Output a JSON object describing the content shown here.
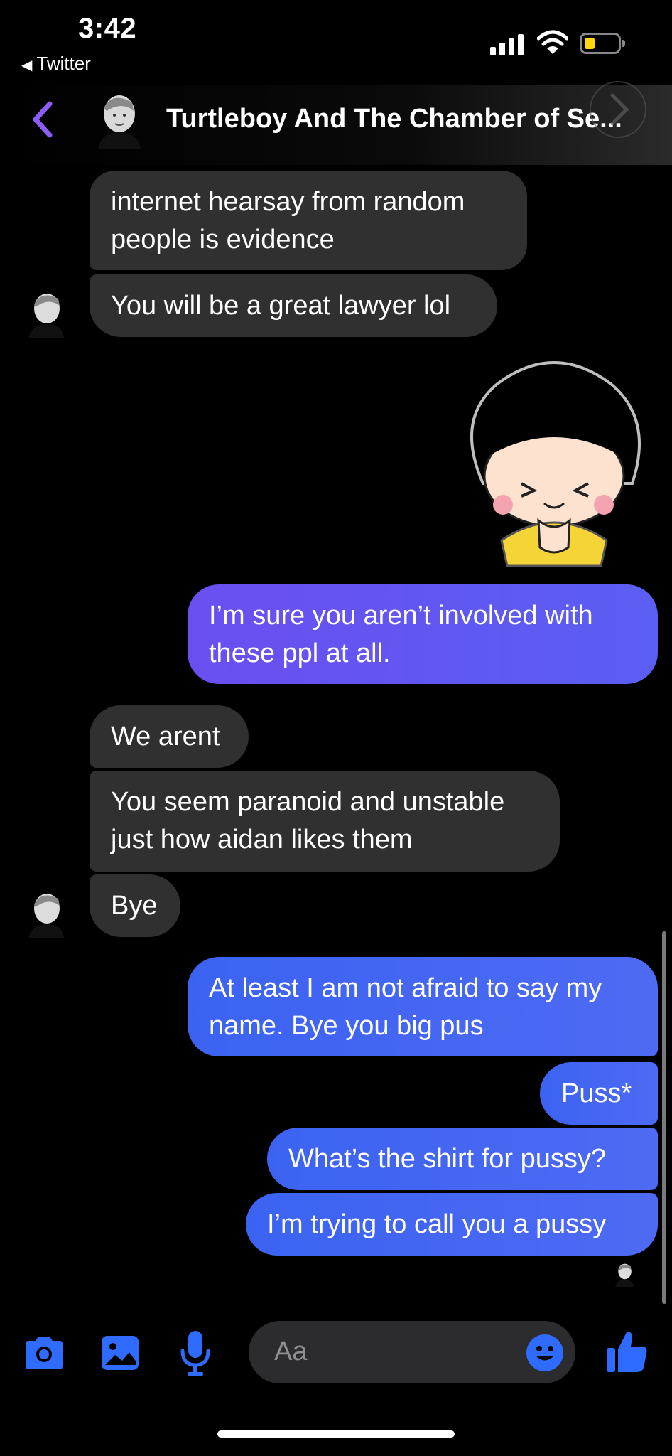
{
  "status_bar": {
    "time": "3:42",
    "back_app": "Twitter"
  },
  "header": {
    "title": "Turtleboy And The Chamber of Se..."
  },
  "messages": [
    {
      "dir": "in",
      "lines": [
        "internet hearsay from random",
        "people is evidence"
      ]
    },
    {
      "dir": "in",
      "lines": [
        "You will be a great lawyer lol"
      ]
    },
    {
      "dir": "out",
      "lines": [
        "I’m sure you aren’t involved with",
        "these ppl at all."
      ]
    },
    {
      "dir": "in",
      "lines": [
        "We arent"
      ]
    },
    {
      "dir": "in",
      "lines": [
        "You seem paranoid and unstable",
        "just how aidan likes them"
      ]
    },
    {
      "dir": "in",
      "lines": [
        "Bye"
      ]
    },
    {
      "dir": "out",
      "lines": [
        "At least I am not afraid to say my",
        "name. Bye you big pus"
      ]
    },
    {
      "dir": "out",
      "lines": [
        "Puss*"
      ]
    },
    {
      "dir": "out",
      "lines": [
        "What’s the shirt for pussy?"
      ]
    },
    {
      "dir": "out",
      "lines": [
        "I’m trying to call you a pussy"
      ]
    }
  ],
  "composer": {
    "placeholder": "Aa"
  },
  "colors": {
    "incoming": "#303030",
    "outgoing": "#4e6af3",
    "accent": "#2f6bff",
    "back": "#8b5cf6"
  },
  "icons": [
    "camera-icon",
    "photo-icon",
    "microphone-icon",
    "emoji-icon",
    "thumbs-up-icon",
    "back-chevron-icon"
  ]
}
